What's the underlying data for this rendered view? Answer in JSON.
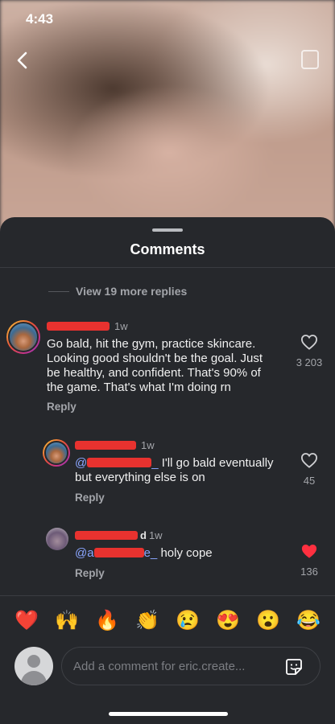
{
  "status": {
    "time": "4:43"
  },
  "sheet": {
    "title": "Comments"
  },
  "thread": {
    "view_more": "View 19 more replies"
  },
  "comments": [
    {
      "time": "1w",
      "text_lines": [
        "Go bald, hit the gym, practice skincare.",
        "Looking good shouldn't be the goal. Just",
        "be healthy, and confident. That's 90% of",
        "the game. That's what I'm doing rn"
      ],
      "reply": "Reply",
      "likes": "3 203",
      "liked": false
    },
    {
      "time": "1w",
      "mention_prefix": "@",
      "mention_suffix": "_",
      "text_after_mention": "I'll go bald eventually",
      "text_line2": "but everything else is on",
      "reply": "Reply",
      "likes": "45",
      "liked": false
    },
    {
      "name_tail": "d",
      "time": "1w",
      "mention_prefix": "@a",
      "mention_suffix": "e_",
      "text_after_mention": "holy cope",
      "reply": "Reply",
      "likes": "136",
      "liked": true
    }
  ],
  "emoji_bar": [
    "❤️",
    "🙌",
    "🔥",
    "👏",
    "😢",
    "😍",
    "😮",
    "😂"
  ],
  "composer": {
    "placeholder": "Add a comment for eric.create..."
  },
  "colors": {
    "like_active": "#ff3040",
    "mention": "#8aa6ff",
    "redaction": "#e8322f"
  }
}
